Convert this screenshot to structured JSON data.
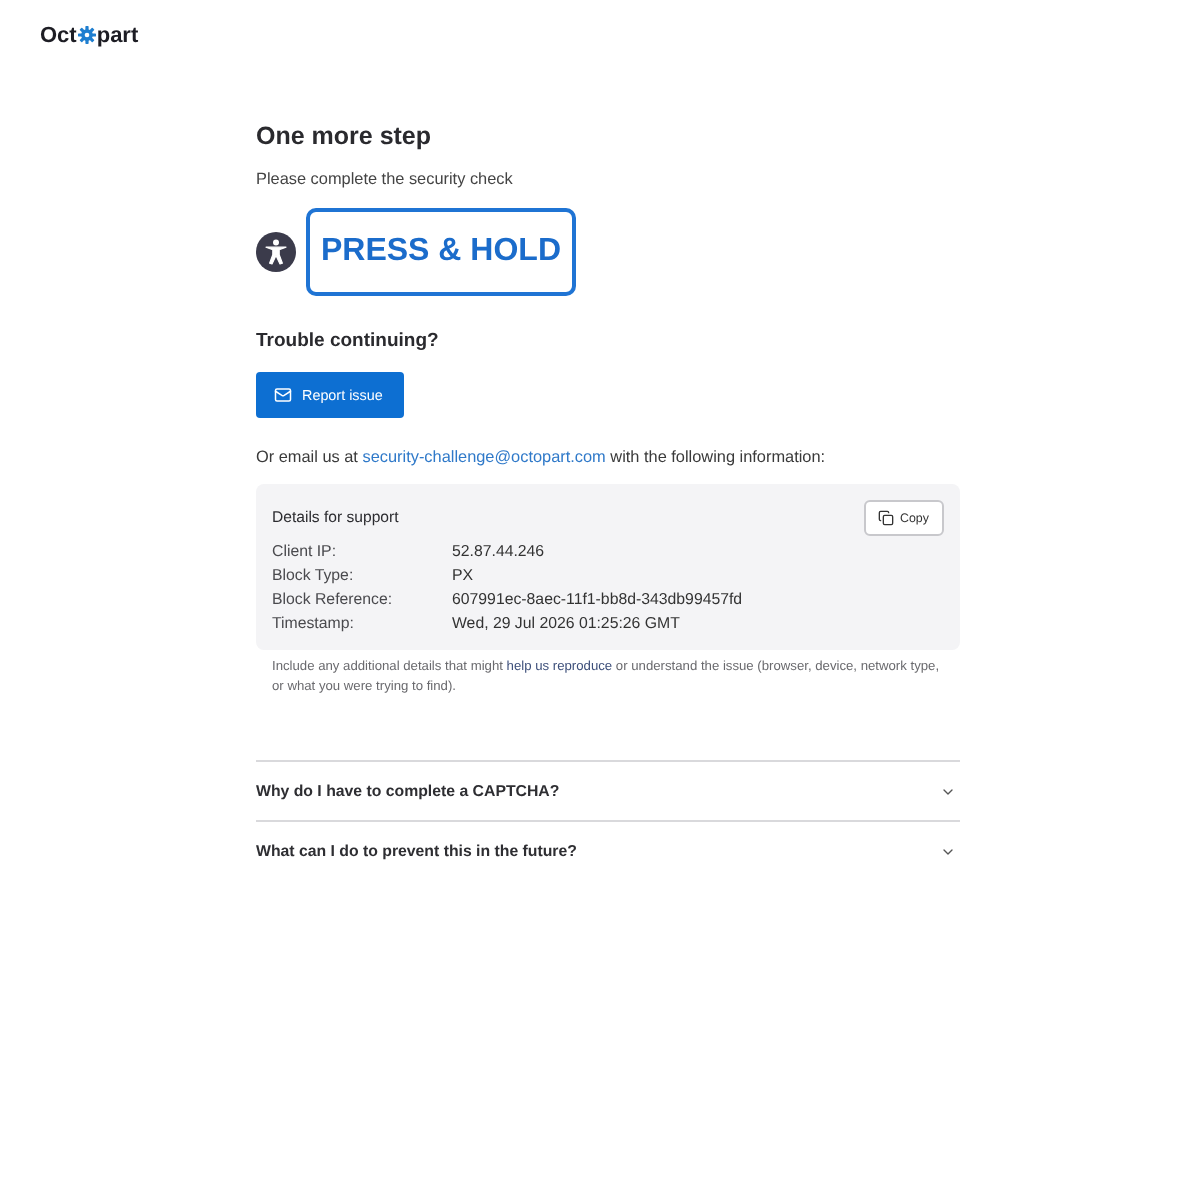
{
  "logo": {
    "start": "Oct",
    "end": "part"
  },
  "heading": "One more step",
  "subheading": "Please complete the security check",
  "challenge": {
    "label": "PRESS & HOLD"
  },
  "trouble": {
    "title": "Trouble continuing?",
    "button": "Report issue"
  },
  "email_line": {
    "before": "Or email us at ",
    "link": "security-challenge@octopart.com",
    "after": " with the following information:"
  },
  "details": {
    "title": "Details for support",
    "copy_button": "Copy",
    "rows": [
      {
        "label": "Client IP:",
        "value": "52.87.44.246"
      },
      {
        "label": "Block Type:",
        "value": "PX"
      },
      {
        "label": "Block Reference:",
        "value": "607991ec-8aec-11f1-bb8d-343db99457fd"
      },
      {
        "label": "Timestamp:",
        "value": "Wed, 29 Jul 2026 01:25:26 GMT"
      }
    ]
  },
  "note": {
    "before": "Include any additional details that might ",
    "link": "help us reproduce",
    "after": " or understand the issue (browser, device, network type, or what you were trying to find)."
  },
  "faq": [
    {
      "question": "Why do I have to complete a CAPTCHA?",
      "expanded": false
    },
    {
      "question": "What can I do to prevent this in the future?",
      "expanded": false
    }
  ]
}
